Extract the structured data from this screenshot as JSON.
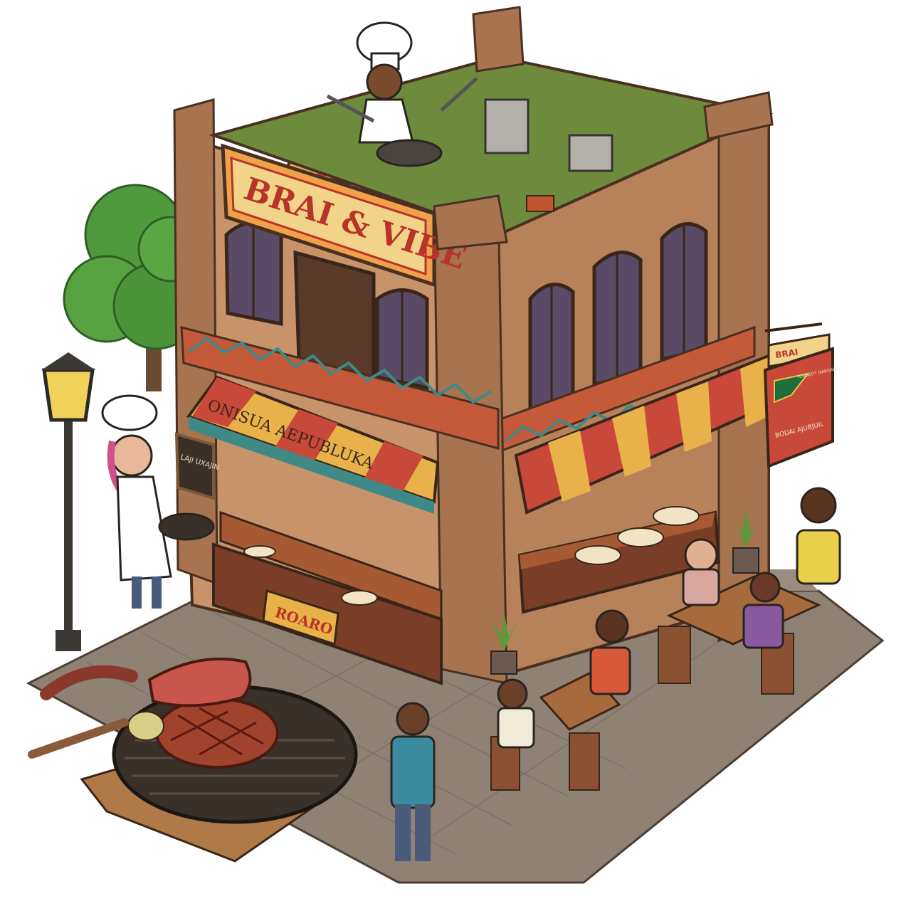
{
  "scene": {
    "roof_sign": "BRAI & VIBE",
    "awning_banner": "ONISUA ΑΕPUBLUKA",
    "counter_sign": "ROARO",
    "left_board": "LAJI UXAJIN",
    "hanging_sign_top": "BRAI",
    "hanging_sign_bottom": "BODAI AJUBJUIL",
    "hanging_sign_small": "TONSEOT NAROAM"
  },
  "colors": {
    "brick": "#b7825a",
    "brick_dark": "#8a5a3c",
    "roof_grass": "#6e8a3c",
    "awning_red": "#c8483a",
    "awning_yellow": "#e8b14a",
    "awning_teal": "#3f8a86",
    "sign_orange": "#e8893a",
    "sign_text": "#b8332a",
    "pavement": "#8f8275",
    "tree_green": "#4f9a3c",
    "grill_dark": "#3a302a",
    "steak": "#a0432c"
  }
}
